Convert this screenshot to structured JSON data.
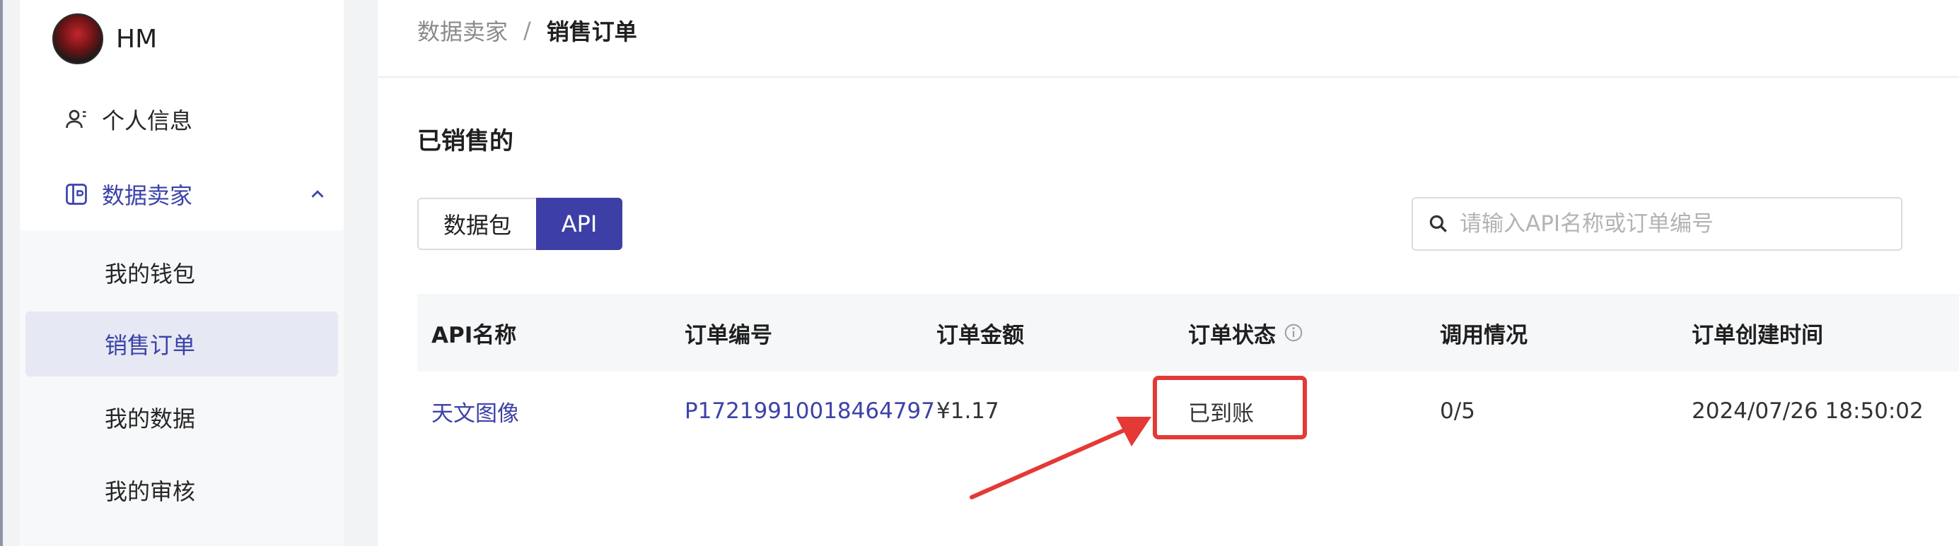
{
  "user": {
    "name": "HM"
  },
  "sidebar": {
    "items": [
      {
        "label": "个人信息",
        "icon": "user-icon"
      },
      {
        "label": "数据卖家",
        "icon": "seller-icon"
      }
    ],
    "subitems": [
      {
        "label": "我的钱包"
      },
      {
        "label": "销售订单"
      },
      {
        "label": "我的数据"
      },
      {
        "label": "我的审核"
      }
    ],
    "accent_color": "#3b42a8"
  },
  "breadcrumb": {
    "parent": "数据卖家",
    "separator": "/",
    "current": "销售订单"
  },
  "section_title": "已销售的",
  "tabs": [
    {
      "label": "数据包"
    },
    {
      "label": "API"
    }
  ],
  "search": {
    "placeholder": "请输入API名称或订单编号",
    "icon": "search-icon"
  },
  "table": {
    "columns": [
      "API名称",
      "订单编号",
      "订单金额",
      "订单状态",
      "调用情况",
      "订单创建时间"
    ],
    "rows": [
      {
        "api_name": "天文图像",
        "order_id": "P17219910018464797",
        "amount": "¥1.17",
        "status": "已到账",
        "usage": "0/5",
        "created": "2024/07/26 18:50:02"
      }
    ]
  },
  "annotation": {
    "color": "#e53935"
  }
}
